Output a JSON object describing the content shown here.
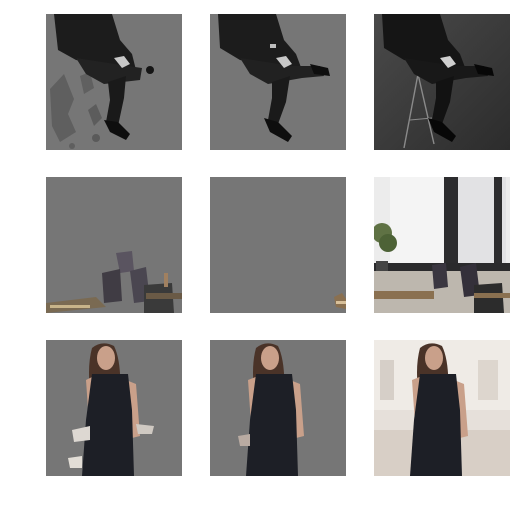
{
  "grid": {
    "rows": [
      {
        "subject": "seated-man",
        "tiles": [
          {
            "variant": "segmented-mask-coarse",
            "background": "#767676"
          },
          {
            "variant": "segmented-mask-fine",
            "background": "#767676"
          },
          {
            "variant": "original",
            "background": "#3c3c3c"
          }
        ]
      },
      {
        "subject": "office-interior",
        "tiles": [
          {
            "variant": "segmented-mask-coarse",
            "background": "#767676"
          },
          {
            "variant": "segmented-mask-fine",
            "background": "#767676"
          },
          {
            "variant": "original",
            "background": "#d9d9d6"
          }
        ]
      },
      {
        "subject": "standing-woman",
        "tiles": [
          {
            "variant": "segmented-mask-coarse",
            "background": "#767676"
          },
          {
            "variant": "segmented-mask-fine",
            "background": "#767676"
          },
          {
            "variant": "original",
            "background": "#e6e0da"
          }
        ]
      }
    ]
  },
  "colors": {
    "mask_gray": "#767676",
    "suit": "#1c1c1c",
    "dress": "#1d1f26",
    "skin": "#c9a08a",
    "hair": "#4a3328"
  }
}
